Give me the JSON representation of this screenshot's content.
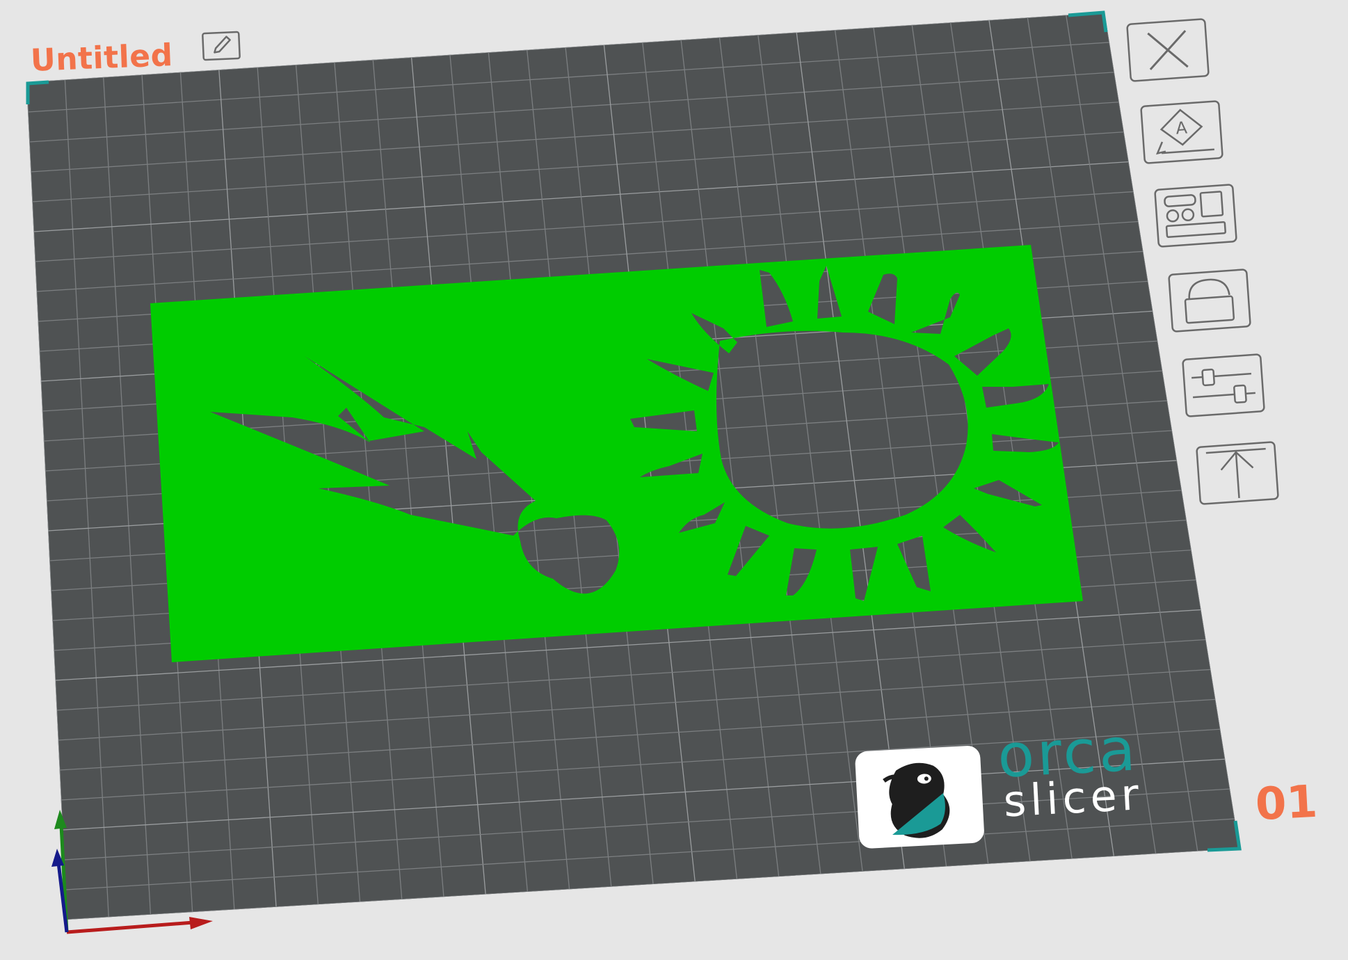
{
  "plate": {
    "title": "Untitled",
    "number": "01"
  },
  "toolbar": {
    "items": [
      {
        "name": "close-plate",
        "icon": "close-icon"
      },
      {
        "name": "auto-orient",
        "icon": "orient-icon"
      },
      {
        "name": "arrange",
        "icon": "arrange-icon"
      },
      {
        "name": "lock",
        "icon": "lock-icon"
      },
      {
        "name": "plate-settings",
        "icon": "sliders-icon"
      },
      {
        "name": "move-to-top",
        "icon": "arrow-up-icon"
      }
    ]
  },
  "logo": {
    "line1": "orca",
    "line2": "slicer"
  },
  "colors": {
    "accent": "#f2734a",
    "bed": "#4f5253",
    "grid": "#7c7f81",
    "model": "#00cc00",
    "teal": "#1a9a96"
  }
}
